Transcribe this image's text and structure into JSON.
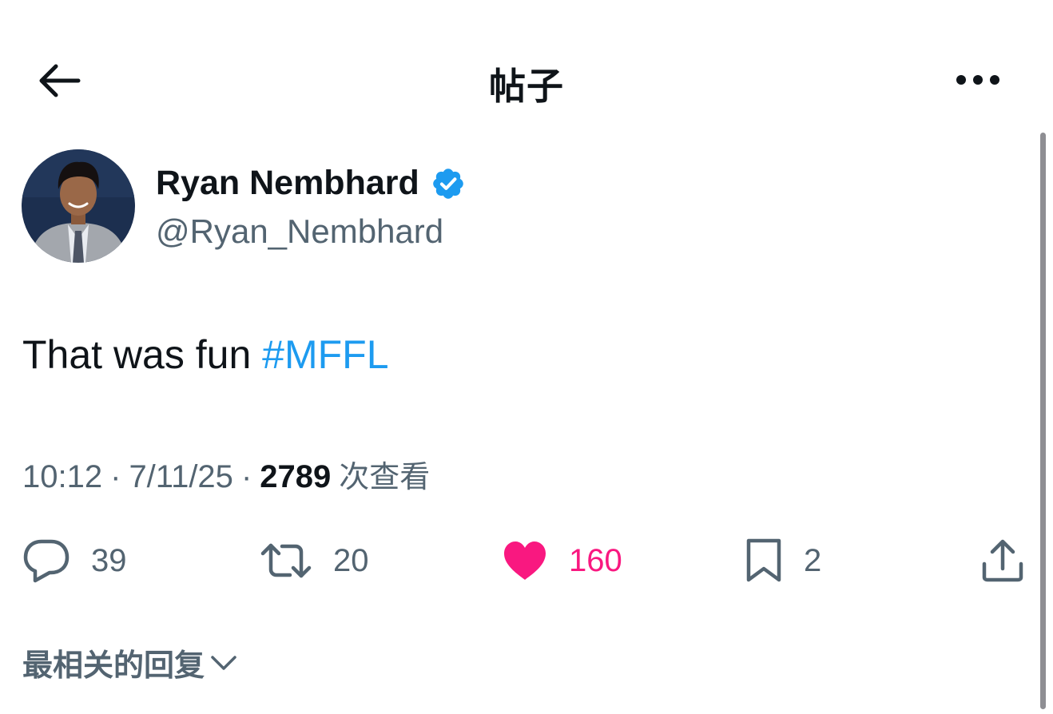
{
  "header": {
    "title": "帖子",
    "back_icon": "arrow-left-icon",
    "more_icon": "more-horizontal-icon"
  },
  "author": {
    "display_name": "Ryan Nembhard",
    "handle": "@Ryan_Nembhard",
    "verified": true,
    "verified_color": "#1d9bf0"
  },
  "tweet": {
    "text": "That was fun ",
    "hashtag": "#MFFL",
    "hashtag_color": "#1d9bf0"
  },
  "meta": {
    "time": "10:12",
    "separator": "·",
    "date": "7/11/25",
    "views": "2789",
    "views_label": "次查看"
  },
  "actions": {
    "replies": {
      "count": "39",
      "icon": "reply-bubble-icon"
    },
    "reposts": {
      "count": "20",
      "icon": "retweet-icon"
    },
    "likes": {
      "count": "160",
      "icon": "heart-filled-icon",
      "color": "#f91880"
    },
    "bookmarks": {
      "count": "2",
      "icon": "bookmark-icon"
    },
    "share": {
      "icon": "share-icon"
    }
  },
  "replies_sort": {
    "label": "最相关的回复",
    "icon": "chevron-down-icon"
  }
}
